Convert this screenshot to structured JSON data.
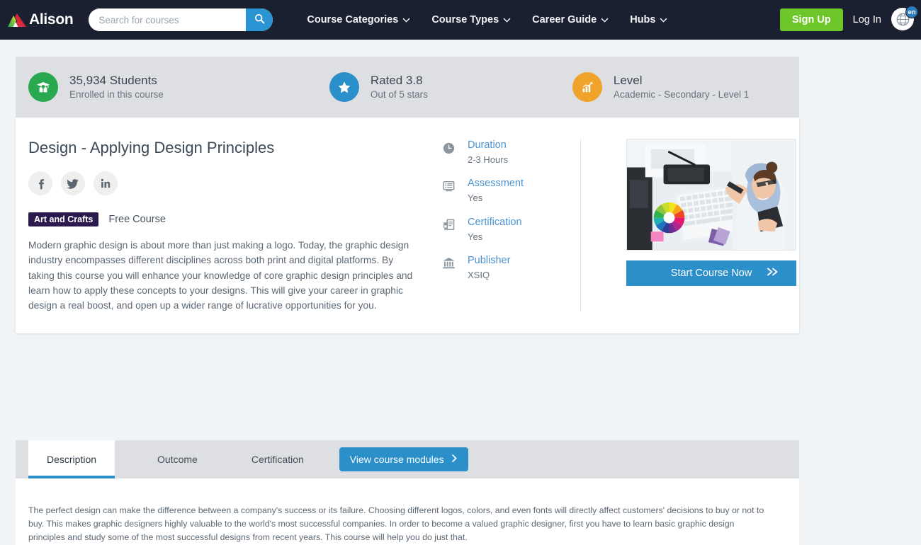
{
  "nav": {
    "brand": "Alison",
    "brand_icon": "alison-logo-icon",
    "search": {
      "placeholder": "Search for courses",
      "value": "",
      "icon": "search-icon"
    },
    "links": [
      {
        "label": "Course Categories",
        "icon": "chevron-down-icon"
      },
      {
        "label": "Course Types",
        "icon": "chevron-down-icon"
      },
      {
        "label": "Career Guide",
        "icon": "chevron-down-icon"
      },
      {
        "label": "Hubs",
        "icon": "chevron-down-icon"
      }
    ],
    "signup_label": "Sign Up",
    "login_label": "Log In",
    "language": {
      "code": "en",
      "icon": "globe-icon"
    },
    "colors": {
      "bar": "#1b2030",
      "signup": "#6dc72b",
      "search_button": "#2b95d3",
      "badge": "#2b7fc0"
    }
  },
  "stats": {
    "background": "#dddfe2",
    "items": [
      {
        "icon": "graduate-cap-icon",
        "icon_color": "#2aa84f",
        "title": "35,934 Students",
        "subtitle": "Enrolled in this course"
      },
      {
        "icon": "star-icon",
        "icon_color": "#2b8fc9",
        "title": "Rated 3.8",
        "subtitle": "Out of 5 stars"
      },
      {
        "icon": "bar-chart-icon",
        "icon_color": "#f0a32a",
        "title": "Level",
        "subtitle": "Academic - Secondary - Level 1"
      }
    ]
  },
  "course": {
    "title": "Design - Applying Design Principles",
    "socials": [
      {
        "name": "facebook-icon",
        "glyph": "f"
      },
      {
        "name": "twitter-icon",
        "glyph": "t"
      },
      {
        "name": "linkedin-icon",
        "glyph": "in"
      }
    ],
    "tag": "Art and Crafts",
    "tag_color": "#2b1a4d",
    "price_label": "Free Course",
    "description": "Modern graphic design is about more than just making a logo. Today, the graphic design industry encompasses different disciplines across both print and digital platforms. By taking this course you will enhance your knowledge of core graphic design principles and learn how to apply these concepts to your designs. This will give your career in graphic design a real boost, and open up a wider range of lucrative opportunities for you.",
    "details": [
      {
        "icon": "clock-icon",
        "label": "Duration",
        "value": "2-3 Hours"
      },
      {
        "icon": "assessment-monitor-icon",
        "label": "Assessment",
        "value": "Yes"
      },
      {
        "icon": "certificate-icon",
        "label": "Certification",
        "value": "Yes"
      },
      {
        "icon": "bank-institution-icon",
        "label": "Publisher",
        "value": "XSIQ"
      }
    ],
    "image_alt": "designer-at-desk-photo",
    "start_button": {
      "label": "Start Course Now",
      "icon": "double-chevron-right-icon",
      "color": "#2b8fc9"
    }
  },
  "tabs": {
    "items": [
      {
        "label": "Description",
        "active": true
      },
      {
        "label": "Outcome",
        "active": false
      },
      {
        "label": "Certification",
        "active": false
      }
    ],
    "modules_button": {
      "label": "View course modules",
      "icon": "chevron-right-icon"
    },
    "active_underline_color": "#2b8fc9",
    "panel_text": "The perfect design can make the difference between a company's success or its failure. Choosing different logos, colors, and even fonts will directly affect customers' decisions to buy or not to buy. This makes graphic designers highly valuable to the world's most successful companies. In order to become a valued graphic designer, first you have to learn basic graphic design principles and study some of the most successful designs from recent years. This course will help you do just that."
  }
}
